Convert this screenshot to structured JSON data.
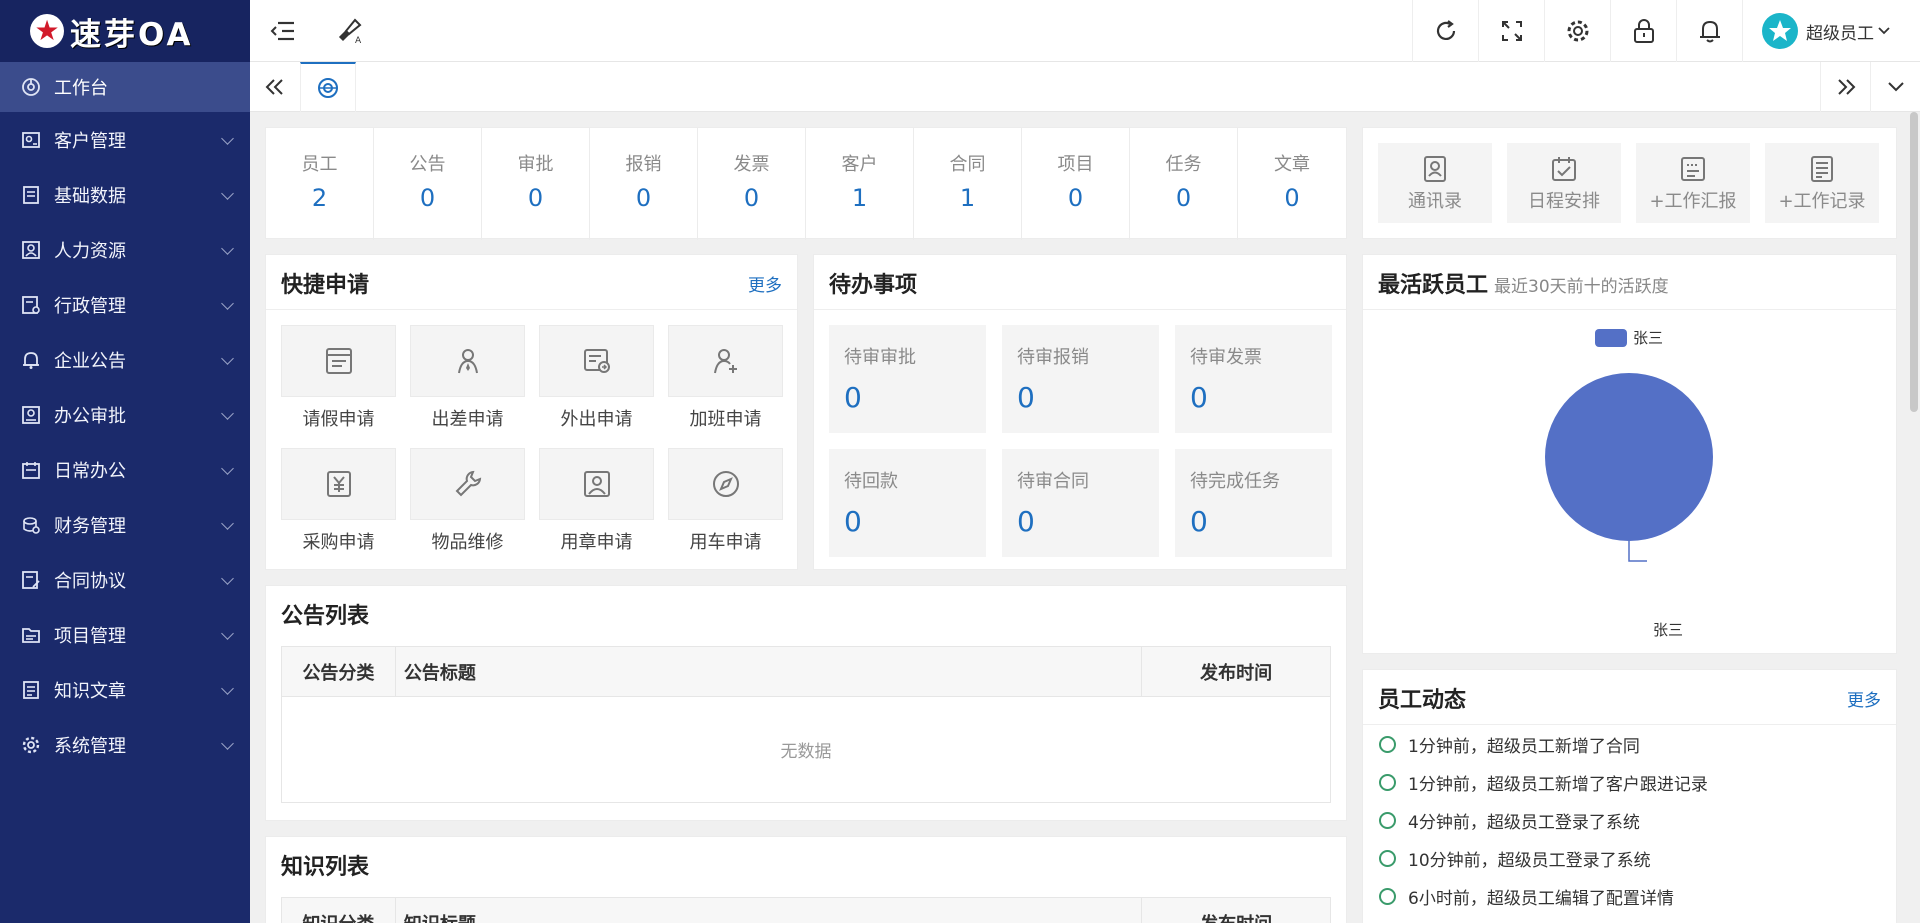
{
  "app": {
    "title": "速芽OA"
  },
  "sidebar": {
    "items": [
      {
        "label": "工作台",
        "icon": "dashboard-icon"
      },
      {
        "label": "客户管理",
        "icon": "customer-icon"
      },
      {
        "label": "基础数据",
        "icon": "data-icon"
      },
      {
        "label": "人力资源",
        "icon": "hr-icon"
      },
      {
        "label": "行政管理",
        "icon": "admin-icon"
      },
      {
        "label": "企业公告",
        "icon": "bell-icon"
      },
      {
        "label": "办公审批",
        "icon": "approval-icon"
      },
      {
        "label": "日常办公",
        "icon": "calendar-icon"
      },
      {
        "label": "财务管理",
        "icon": "finance-icon"
      },
      {
        "label": "合同协议",
        "icon": "contract-icon"
      },
      {
        "label": "项目管理",
        "icon": "project-icon"
      },
      {
        "label": "知识文章",
        "icon": "article-icon"
      },
      {
        "label": "系统管理",
        "icon": "settings-icon"
      }
    ]
  },
  "header": {
    "user_name": "超级员工"
  },
  "stats": [
    {
      "label": "员工",
      "value": "2"
    },
    {
      "label": "公告",
      "value": "0"
    },
    {
      "label": "审批",
      "value": "0"
    },
    {
      "label": "报销",
      "value": "0"
    },
    {
      "label": "发票",
      "value": "0"
    },
    {
      "label": "客户",
      "value": "1"
    },
    {
      "label": "合同",
      "value": "1"
    },
    {
      "label": "项目",
      "value": "0"
    },
    {
      "label": "任务",
      "value": "0"
    },
    {
      "label": "文章",
      "value": "0"
    }
  ],
  "tools": [
    {
      "label": "通讯录"
    },
    {
      "label": "日程安排"
    },
    {
      "label": "+工作汇报"
    },
    {
      "label": "+工作记录"
    }
  ],
  "quick": {
    "title": "快捷申请",
    "more": "更多",
    "items": [
      {
        "label": "请假申请"
      },
      {
        "label": "出差申请"
      },
      {
        "label": "外出申请"
      },
      {
        "label": "加班申请"
      },
      {
        "label": "采购申请"
      },
      {
        "label": "物品维修"
      },
      {
        "label": "用章申请"
      },
      {
        "label": "用车申请"
      }
    ]
  },
  "pending": {
    "title": "待办事项",
    "items": [
      {
        "label": "待审审批",
        "value": "0"
      },
      {
        "label": "待审报销",
        "value": "0"
      },
      {
        "label": "待审发票",
        "value": "0"
      },
      {
        "label": "待回款",
        "value": "0"
      },
      {
        "label": "待审合同",
        "value": "0"
      },
      {
        "label": "待完成任务",
        "value": "0"
      }
    ]
  },
  "notices": {
    "title": "公告列表",
    "columns": [
      "公告分类",
      "公告标题",
      "发布时间"
    ],
    "empty": "无数据"
  },
  "knowledge": {
    "title": "知识列表",
    "columns": [
      "知识分类",
      "知识标题",
      "发布时间"
    ]
  },
  "active": {
    "title": "最活跃员工",
    "subtitle": "最近30天前十的活跃度",
    "legend": "张三",
    "slice_label": "张三",
    "color": "#5470c6"
  },
  "chart_data": {
    "type": "pie",
    "title": "最活跃员工",
    "subtitle": "最近30天前十的活跃度",
    "categories": [
      "张三"
    ],
    "values": [
      1
    ],
    "legend": "top-center"
  },
  "feed": {
    "title": "员工动态",
    "more": "更多",
    "items": [
      {
        "text": "1分钟前，超级员工新增了合同"
      },
      {
        "text": "1分钟前，超级员工新增了客户跟进记录"
      },
      {
        "text": "4分钟前，超级员工登录了系统"
      },
      {
        "text": "10分钟前，超级员工登录了系统"
      },
      {
        "text": "6小时前，超级员工编辑了配置详情"
      }
    ]
  }
}
